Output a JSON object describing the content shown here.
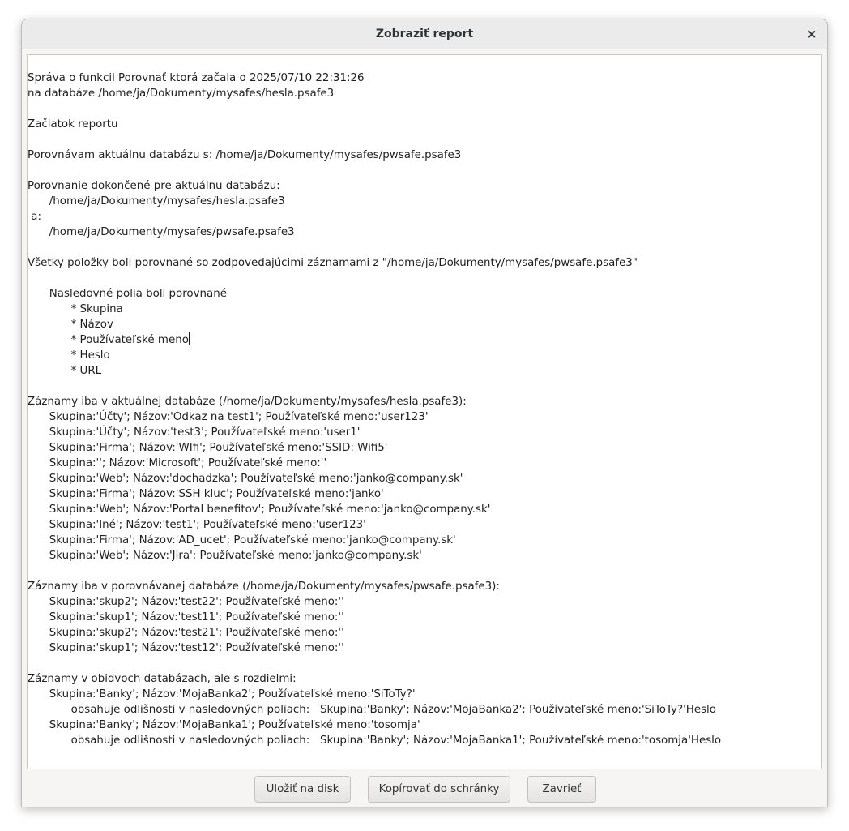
{
  "window": {
    "title": "Zobraziť report",
    "close_glyph": "×"
  },
  "report": {
    "lines": [
      "Správa o funkcii Porovnať ktorá začala o 2025/07/10 22:31:26",
      "na databáze /home/ja/Dokumenty/mysafes/hesla.psafe3",
      "",
      "Začiatok reportu",
      "",
      "Porovnávam aktuálnu databázu s: /home/ja/Dokumenty/mysafes/pwsafe.psafe3",
      "",
      "Porovnanie dokončené pre aktuálnu databázu:",
      "\t/home/ja/Dokumenty/mysafes/hesla.psafe3",
      " a:",
      "\t/home/ja/Dokumenty/mysafes/pwsafe.psafe3",
      "",
      "Všetky položky boli porovnané so zodpovedajúcimi záznamami z \"/home/ja/Dokumenty/mysafes/pwsafe.psafe3\"",
      "",
      "\tNasledovné polia boli porovnané",
      "\t\t* Skupina",
      "\t\t* Názov",
      "\t\t* Používateľské meno",
      "\t\t* Heslo",
      "\t\t* URL",
      "",
      "Záznamy iba v aktuálnej databáze (/home/ja/Dokumenty/mysafes/hesla.psafe3):",
      "\tSkupina:'Účty'; Názov:'Odkaz na test1'; Používateľské meno:'user123'",
      "\tSkupina:'Účty'; Názov:'test3'; Používateľské meno:'user1'",
      "\tSkupina:'Firma'; Názov:'WIfi'; Používateľské meno:'SSID: Wifi5'",
      "\tSkupina:''; Názov:'Microsoft'; Používateľské meno:''",
      "\tSkupina:'Web'; Názov:'dochadzka'; Používateľské meno:'janko@company.sk'",
      "\tSkupina:'Firma'; Názov:'SSH kluc'; Používateľské meno:'janko'",
      "\tSkupina:'Web'; Názov:'Portal benefitov'; Používateľské meno:'janko@company.sk'",
      "\tSkupina:'Iné'; Názov:'test1'; Používateľské meno:'user123'",
      "\tSkupina:'Firma'; Názov:'AD_ucet'; Používateľské meno:'janko@company.sk'",
      "\tSkupina:'Web'; Názov:'Jira'; Používateľské meno:'janko@company.sk'",
      "",
      "Záznamy iba v porovnávanej databáze (/home/ja/Dokumenty/mysafes/pwsafe.psafe3):",
      "\tSkupina:'skup2'; Názov:'test22'; Používateľské meno:''",
      "\tSkupina:'skup1'; Názov:'test11'; Používateľské meno:''",
      "\tSkupina:'skup2'; Názov:'test21'; Používateľské meno:''",
      "\tSkupina:'skup1'; Názov:'test12'; Používateľské meno:''",
      "",
      "Záznamy v obidvoch databázach, ale s rozdielmi:",
      "\tSkupina:'Banky'; Názov:'MojaBanka2'; Používateľské meno:'SiToTy?'",
      "\t\tobsahuje odlišnosti v nasledovných poliach:   Skupina:'Banky'; Názov:'MojaBanka2'; Používateľské meno:'SiToTy?'Heslo",
      "\tSkupina:'Banky'; Názov:'MojaBanka1'; Používateľské meno:'tosomja'",
      "\t\tobsahuje odlišnosti v nasledovných poliach:   Skupina:'Banky'; Názov:'MojaBanka1'; Používateľské meno:'tosomja'Heslo"
    ]
  },
  "buttons": {
    "save": "Uložiť na disk",
    "copy": "Kopírovať do schránky",
    "close": "Zavrieť"
  }
}
